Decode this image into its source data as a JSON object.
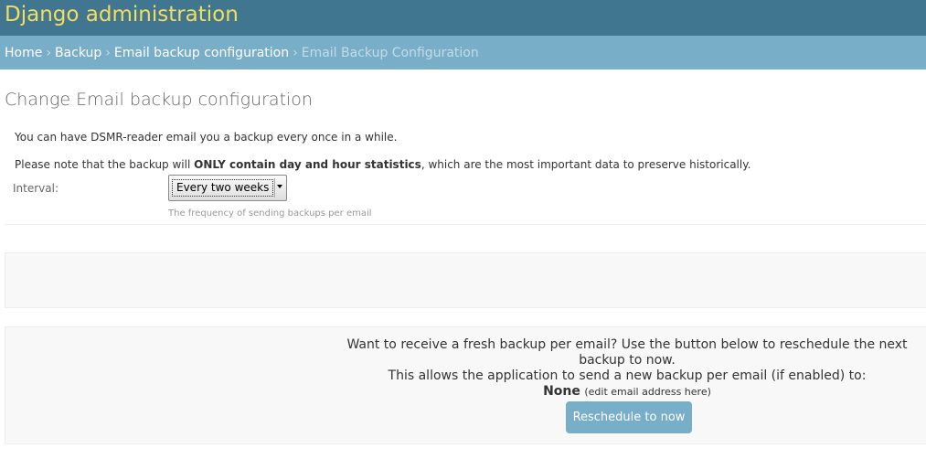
{
  "header": {
    "site_title": "Django administration"
  },
  "breadcrumbs": {
    "items": [
      "Home",
      "Backup",
      "Email backup configuration"
    ],
    "current": "Email Backup Configuration",
    "separator": "›"
  },
  "page": {
    "title": "Change Email backup configuration"
  },
  "intro": {
    "p1": "You can have DSMR-reader email you a backup every once in a while.",
    "p2_before": "Please note that the backup will ",
    "p2_bold": "ONLY contain day and hour statistics",
    "p2_after": ", which are the most important data to preserve historically."
  },
  "form": {
    "interval_label": "Interval:",
    "interval_value": "Every two weeks",
    "interval_help": "The frequency of sending backups per email"
  },
  "reschedule": {
    "line1": "Want to receive a fresh backup per email? Use the button below to reschedule the next backup to now.",
    "line2": "This allows the application to send a new backup per email (if enabled) to:",
    "email_value": "None",
    "edit_link_open": "(",
    "edit_link_text": "edit email address here",
    "edit_link_close": ")",
    "button_label": "Reschedule to now"
  },
  "colors": {
    "header_bg": "#417690",
    "title_color": "#f5dd5d",
    "breadcrumb_bg": "#79aec8",
    "button_bg": "#79aec8",
    "link_color": "#447e9b"
  }
}
